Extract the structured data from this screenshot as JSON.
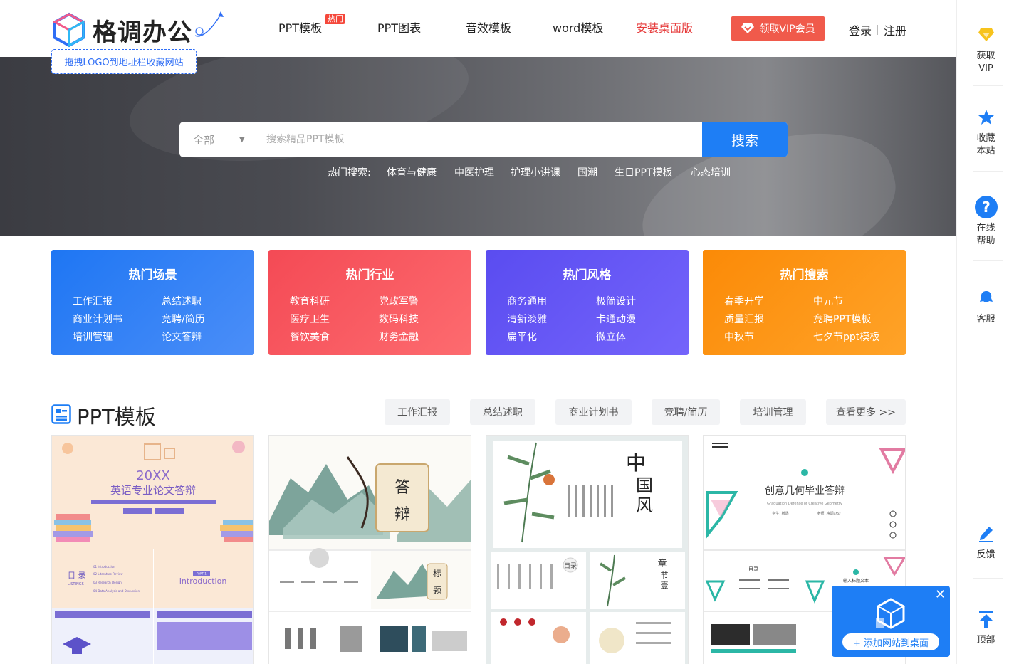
{
  "brand": {
    "logo_text": "格调办公",
    "logo_tip": "拖拽LOGO到地址栏收藏网站",
    "accent": "#1e7ef5"
  },
  "nav": {
    "items": [
      {
        "label": "PPT模板",
        "badge": "热门"
      },
      {
        "label": "PPT图表"
      },
      {
        "label": "音效模板"
      },
      {
        "label": "word模板"
      },
      {
        "label": "安装桌面版"
      }
    ],
    "vip_label": "领取VIP会员",
    "login": "登录",
    "register": "注册"
  },
  "search": {
    "category": "全部",
    "placeholder": "搜索精品PPT模板",
    "button": "搜索",
    "hot_label": "热门搜索:",
    "hot_terms": [
      "体育与健康",
      "中医护理",
      "护理小讲课",
      "国潮",
      "生日PPT模板",
      "心态培训"
    ]
  },
  "categories": [
    {
      "title": "热门场景",
      "items": [
        "工作汇报",
        "总结述职",
        "商业计划书",
        "竞聘/简历",
        "培训管理",
        "论文答辩"
      ],
      "color": "#1e76f3"
    },
    {
      "title": "热门行业",
      "items": [
        "教育科研",
        "党政军警",
        "医疗卫生",
        "数码科技",
        "餐饮美食",
        "财务金融"
      ],
      "color": "#f44a55"
    },
    {
      "title": "热门风格",
      "items": [
        "商务通用",
        "极简设计",
        "清新淡雅",
        "卡通动漫",
        "扁平化",
        "微立体"
      ],
      "color": "#5a4cf0"
    },
    {
      "title": "热门搜索",
      "items": [
        "春季开学",
        "中元节",
        "质量汇报",
        "竞聘PPT模板",
        "中秋节",
        "七夕节ppt模板"
      ],
      "color": "#fb8a07"
    }
  ],
  "ppt_section": {
    "title": "PPT模板",
    "tags": [
      "工作汇报",
      "总结述职",
      "商业计划书",
      "竞聘/简历",
      "培训管理",
      "查看更多 >>"
    ]
  },
  "thumbnails": [
    {
      "cover_title": "20XX",
      "cover_subtitle": "英语专业论文答辩",
      "slide_a_heading": "目 录",
      "slide_a_sub": "LISTINGS",
      "slide_b_heading": "Introduction",
      "slide_b_tag": "PART 1",
      "list_items": [
        "01 Introduction",
        "02 Literature Review",
        "03 Research Design",
        "04 Data Analysis and Discussion"
      ]
    },
    {
      "cover_title_1": "答",
      "cover_title_2": "辩",
      "slide_heading_1": "标",
      "slide_heading_2": "题"
    },
    {
      "cover_title_1": "中",
      "cover_title_2": "国",
      "cover_title_3": "风",
      "slide_a_heading": "目录",
      "slide_b_heading_1": "章",
      "slide_b_heading_2": "节",
      "slide_b_heading_3": "壹"
    },
    {
      "cover_title": "创意几何毕业答辩",
      "cover_subtitle": "Graduation Defense of Creative Geometry",
      "student_label": "学生: 板遇",
      "teacher_label": "老师: 格调办公",
      "slide_a_heading": "目录",
      "slide_b_heading": "输入标题文本"
    }
  ],
  "rail": [
    {
      "label": "获取VIP",
      "icon": "diamond-icon"
    },
    {
      "label": "收藏本站",
      "icon": "star-icon"
    },
    {
      "label": "在线帮助",
      "icon": "help-icon"
    },
    {
      "label": "客服",
      "icon": "customer-service-icon"
    },
    {
      "label": "反馈",
      "icon": "pen-icon"
    },
    {
      "label": "顶部",
      "icon": "back-to-top-icon"
    }
  ],
  "desktop_popup": {
    "button": "+ 添加网站到桌面"
  }
}
